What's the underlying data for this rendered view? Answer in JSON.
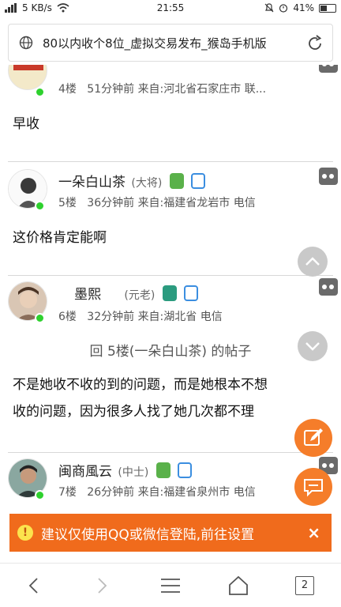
{
  "status_bar": {
    "left_text": "5 KB/s",
    "time": "21:55",
    "battery": "41%"
  },
  "url_bar": {
    "title": "80以内收个8位_虚拟交易发布_猴岛手机版"
  },
  "posts": [
    {
      "username": "",
      "floor": "4楼",
      "time_ago": "51分钟前",
      "source": "来自:河北省石家庄市 联...",
      "body": [
        "早收"
      ]
    },
    {
      "username": "一朵白山茶",
      "rank": "(大将)",
      "floor": "5楼",
      "time_ago": "36分钟前",
      "source": "来自:福建省龙岩市 电信",
      "body": [
        "这价格肯定能啊"
      ]
    },
    {
      "username": "墨熙",
      "rank": "(元老)",
      "floor": "6楼",
      "time_ago": "32分钟前",
      "source": "来自:湖北省 电信",
      "reply": "回 5楼(一朵白山茶) 的帖子",
      "body": [
        "不是她收不收的到的问题，而是她根本不想",
        "收的问题，因为很多人找了她几次都不理"
      ]
    },
    {
      "username": "闽商風云",
      "rank": "(中士)",
      "floor": "7楼",
      "time_ago": "26分钟前",
      "source": "来自:福建省泉州市 电信"
    }
  ],
  "notice": {
    "icon": "!",
    "text": "建议仅使用QQ或微信登陆,前往设置",
    "close": "×"
  },
  "bottom_nav": {
    "tab_count": "2"
  },
  "colors": {
    "accent_orange": "#f57d2a",
    "notice_bg": "#f06b1c",
    "online_green": "#2ed12e"
  }
}
